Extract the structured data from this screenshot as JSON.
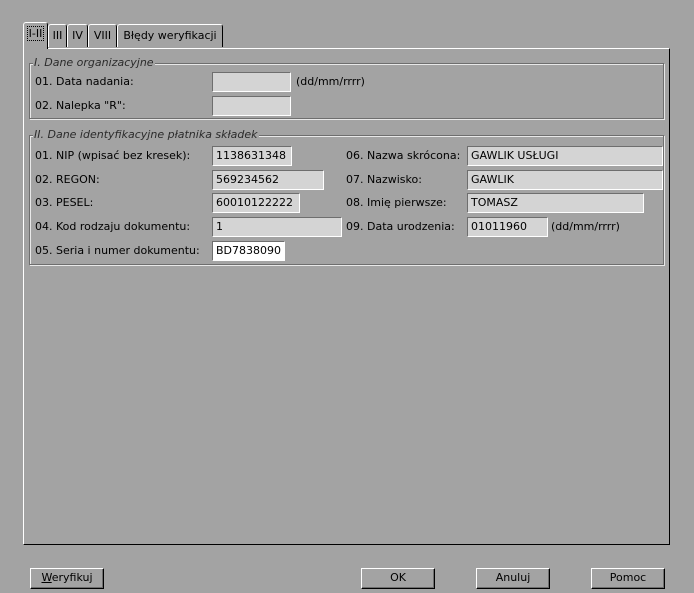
{
  "tabs": [
    "I-II",
    "III",
    "IV",
    "VIII",
    "Błędy weryfikacji"
  ],
  "section1": {
    "legend": "I. Dane organizacyjne",
    "fields": {
      "data_nadania": {
        "label": "01. Data nadania:",
        "value": "",
        "hint": "(dd/mm/rrrr)"
      },
      "nalepka_r": {
        "label": "02. Nalepka \"R\":",
        "value": ""
      }
    }
  },
  "section2": {
    "legend": "II. Dane identyfikacyjne płatnika składek",
    "fields": {
      "nip": {
        "label": "01. NIP (wpisać bez kresek):",
        "value": "1138631348"
      },
      "regon": {
        "label": "02. REGON:",
        "value": "569234562"
      },
      "pesel": {
        "label": "03. PESEL:",
        "value": "60010122222"
      },
      "kod_dok": {
        "label": "04. Kod rodzaju dokumentu:",
        "value": "1"
      },
      "seria_dok": {
        "label": "05. Seria i numer dokumentu:",
        "value": "BD7838090"
      },
      "nazwa": {
        "label": "06. Nazwa skrócona:",
        "value": "GAWLIK USŁUGI"
      },
      "nazwisko": {
        "label": "07. Nazwisko:",
        "value": "GAWLIK"
      },
      "imie": {
        "label": "08. Imię pierwsze:",
        "value": "TOMASZ"
      },
      "data_ur": {
        "label": "09. Data urodzenia:",
        "value": "01011960",
        "hint": "(dd/mm/rrrr)"
      }
    }
  },
  "buttons": {
    "verify_prefix": "W",
    "verify_rest": "eryfikuj",
    "ok": "OK",
    "cancel": "Anuluj",
    "help": "Pomoc"
  }
}
